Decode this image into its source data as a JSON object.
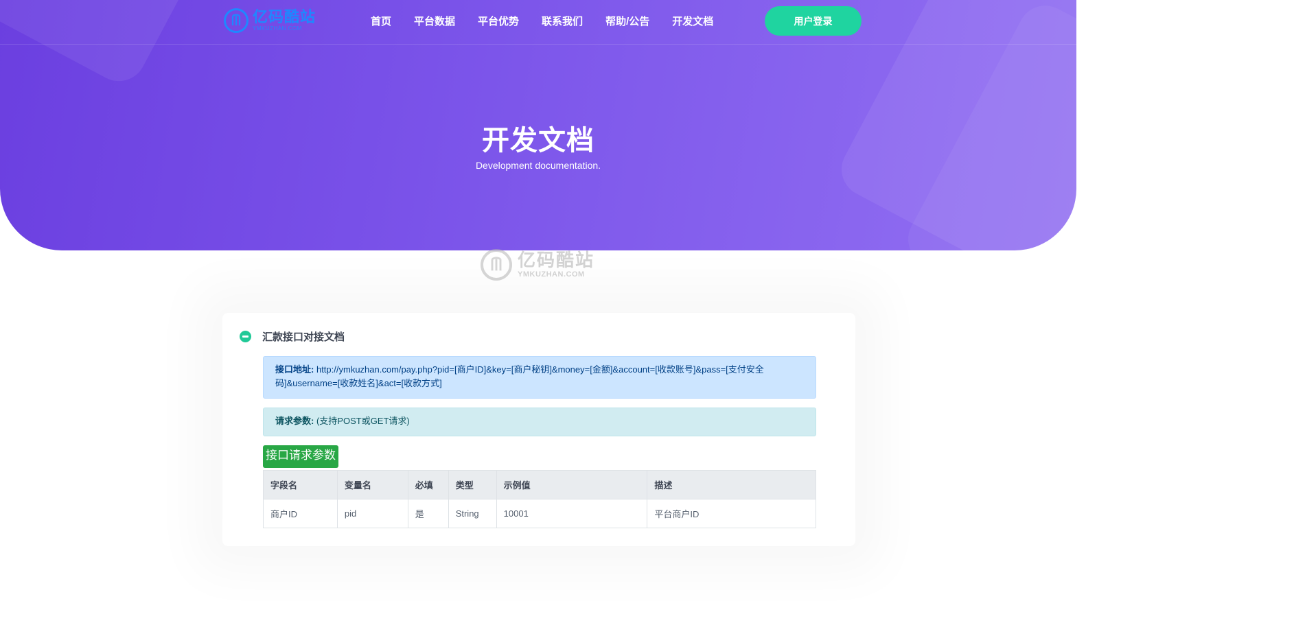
{
  "nav": {
    "logo_cn": "亿码酷站",
    "logo_en": "YMKUZHAN.COM",
    "menu": [
      "首页",
      "平台数据",
      "平台优势",
      "联系我们",
      "帮助/公告",
      "开发文档"
    ],
    "login_label": "用户登录"
  },
  "hero": {
    "title": "开发文档",
    "subtitle": "Development documentation."
  },
  "watermark": {
    "cn": "亿码酷站",
    "en": "YMKUZHAN.COM"
  },
  "section": {
    "title": "汇款接口对接文档",
    "endpoint_label": "接口地址:",
    "endpoint_value": "http://ymkuzhan.com/pay.php?pid=[商户ID]&key=[商户秘钥]&money=[金额]&account=[收款账号]&pass=[支付安全码]&username=[收款姓名]&act=[收款方式]",
    "params_label": "请求参数:",
    "params_value": "(支持POST或GET请求)",
    "badge": "接口请求参数"
  },
  "table": {
    "headers": [
      "字段名",
      "变量名",
      "必填",
      "类型",
      "示例值",
      "描述"
    ],
    "rows": [
      [
        "商户ID",
        "pid",
        "是",
        "String",
        "10001",
        "平台商户ID"
      ]
    ]
  },
  "colors": {
    "hero_gradient_start": "#6b3fe0",
    "hero_gradient_end": "#9270f2",
    "login_button": "#1fd4a0",
    "logo_blue": "#1e88ff",
    "badge_green": "#28a745"
  }
}
